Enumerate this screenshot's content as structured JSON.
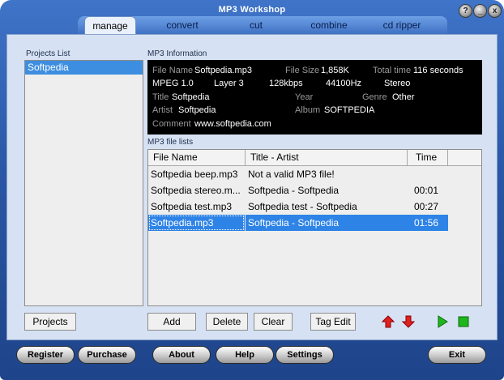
{
  "window": {
    "title": "MP3 Workshop",
    "buttons": [
      "?",
      "_",
      "x"
    ]
  },
  "tabs": [
    {
      "label": "manage",
      "active": true
    },
    {
      "label": "convert",
      "active": false
    },
    {
      "label": "cut",
      "active": false
    },
    {
      "label": "combine",
      "active": false
    },
    {
      "label": "cd ripper",
      "active": false
    }
  ],
  "projects": {
    "label": "Projects List",
    "items": [
      "Softpedia"
    ],
    "selected": "Softpedia",
    "button": "Projects"
  },
  "mp3_info": {
    "label": "MP3 Information",
    "file_name_label": "File Name",
    "file_name": "Softpedia.mp3",
    "file_size_label": "File Size",
    "file_size": "1,858K",
    "total_time_label": "Total time",
    "total_time": "116 seconds",
    "mpeg": "MPEG 1.0",
    "layer": "Layer 3",
    "bitrate": "128kbps",
    "frequency": "44100Hz",
    "channels": "Stereo",
    "title_label": "Title",
    "title": "Softpedia",
    "year_label": "Year",
    "year": "",
    "genre_label": "Genre",
    "genre": "Other",
    "artist_label": "Artist",
    "artist": "Softpedia",
    "album_label": "Album",
    "album": "SOFTPEDIA",
    "comment_label": "Comment",
    "comment": "www.softpedia.com"
  },
  "file_list": {
    "label": "MP3 file lists",
    "columns": [
      "File Name",
      "Title - Artist",
      "Time"
    ],
    "rows": [
      {
        "file": "Softpedia beep.mp3",
        "title": "Not a valid MP3 file!",
        "time": "",
        "selected": false
      },
      {
        "file": "Softpedia stereo.m...",
        "title": "Softpedia - Softpedia",
        "time": "00:01",
        "selected": false
      },
      {
        "file": "Softpedia test.mp3",
        "title": "Softpedia test - Softpedia",
        "time": "00:27",
        "selected": false
      },
      {
        "file": "Softpedia.mp3",
        "title": "Softpedia - Softpedia",
        "time": "01:56",
        "selected": true
      }
    ],
    "buttons": {
      "add": "Add",
      "delete": "Delete",
      "clear": "Clear",
      "tag_edit": "Tag Edit"
    }
  },
  "bottom_buttons": {
    "register": "Register",
    "purchase": "Purchase",
    "about": "About",
    "help": "Help",
    "settings": "Settings",
    "exit": "Exit"
  },
  "colors": {
    "window_blue": "#2a57a6",
    "panel": "#d6e2f3",
    "selection": "#2e83e6",
    "arrow_red": "#e02020",
    "play_green": "#1fb51f"
  },
  "icons": [
    "help-icon",
    "minimize-icon",
    "close-icon",
    "arrow-up-icon",
    "arrow-down-icon",
    "play-icon",
    "stop-icon"
  ]
}
